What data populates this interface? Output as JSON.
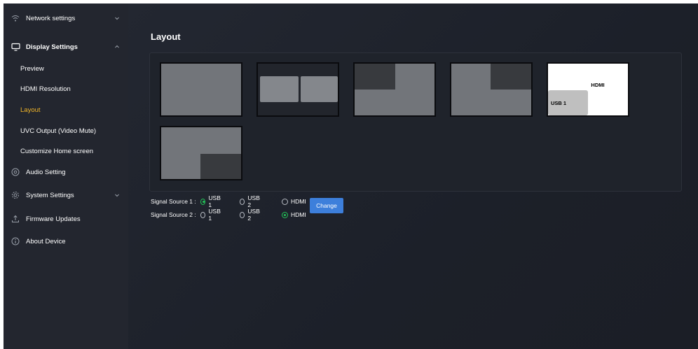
{
  "sidebar": {
    "items": [
      {
        "label": "Network settings",
        "icon": "wifi-icon"
      },
      {
        "label": "Display Settings",
        "icon": "monitor-icon"
      },
      {
        "label": "Preview"
      },
      {
        "label": "HDMI Resolution"
      },
      {
        "label": "Layout"
      },
      {
        "label": "UVC Output (Video Mute)"
      },
      {
        "label": "Customize Home screen"
      },
      {
        "label": "Audio Setting",
        "icon": "audio-icon"
      },
      {
        "label": "System Settings",
        "icon": "gear-icon"
      },
      {
        "label": "Firmware Updates",
        "icon": "upload-icon"
      },
      {
        "label": "About Device",
        "icon": "info-icon"
      }
    ],
    "active_item": "Layout"
  },
  "main": {
    "title": "Layout",
    "tiles": [
      {
        "kind": "full"
      },
      {
        "kind": "side-by-side"
      },
      {
        "kind": "pip-top-left"
      },
      {
        "kind": "pip-top-right"
      },
      {
        "kind": "pip-bottom-left-labeled",
        "main_label": "HDMI",
        "pip_label": "USB 1"
      },
      {
        "kind": "pip-bottom-right"
      }
    ],
    "signal_sources": [
      {
        "label": "Signal Source 1 :",
        "options": [
          "USB 1",
          "USB 2",
          "HDMI"
        ],
        "selected": "USB 1"
      },
      {
        "label": "Signal Source 2 :",
        "options": [
          "USB 1",
          "USB 2",
          "HDMI"
        ],
        "selected": "HDMI"
      }
    ],
    "change_button": "Change"
  },
  "colors": {
    "accent": "#3d7fdb",
    "active_nav": "#f0b429",
    "radio_selected": "#23c458"
  }
}
